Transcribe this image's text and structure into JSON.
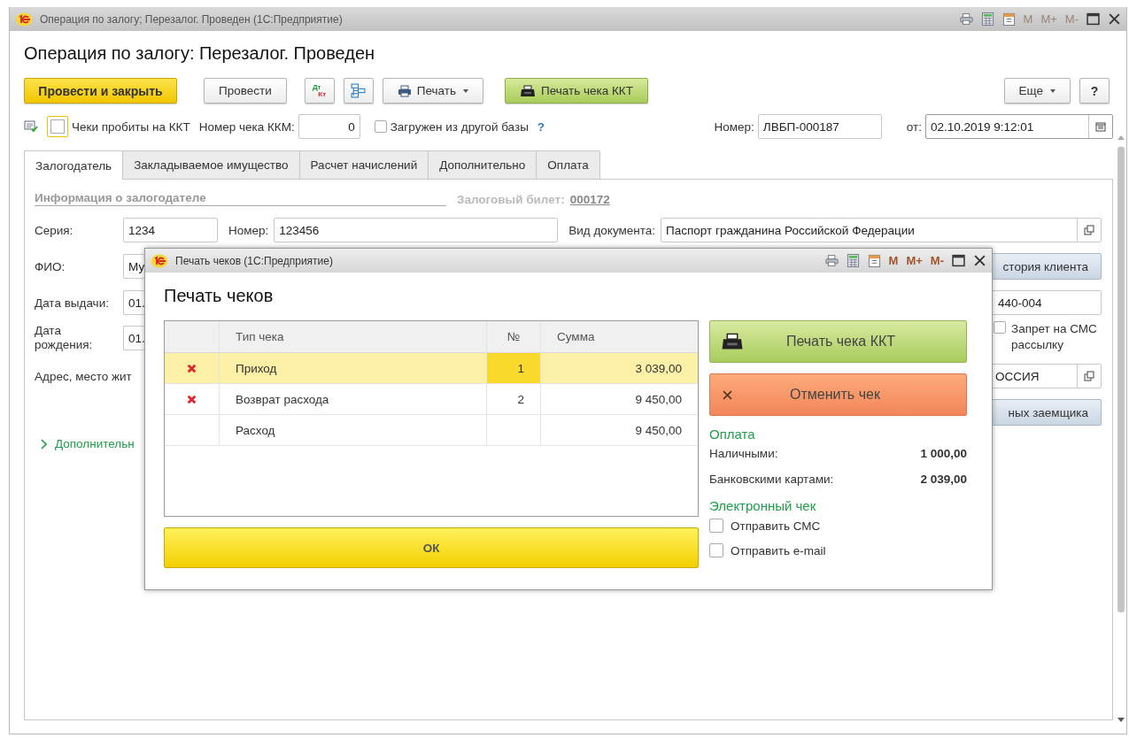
{
  "window": {
    "title": "Операция по залогу; Перезалог. Проведен  (1С:Предприятие)",
    "title_tools": [
      {
        "kind": "print"
      },
      {
        "kind": "calc"
      },
      {
        "kind": "calendar"
      },
      {
        "kind": "mem",
        "label": "M",
        "disabled": true
      },
      {
        "kind": "mem",
        "label": "M+",
        "disabled": true
      },
      {
        "kind": "mem",
        "label": "M-",
        "disabled": true
      },
      {
        "kind": "maximize"
      },
      {
        "kind": "close"
      }
    ]
  },
  "heading": "Операция по залогу: Перезалог. Проведен",
  "toolbar_left": [
    {
      "kind": "primary",
      "label": "Провести и закрыть"
    },
    {
      "kind": "plain",
      "label": "Провести"
    },
    {
      "kind": "dtkt",
      "label": "Дт",
      "label2": "Кт"
    },
    {
      "kind": "structure"
    },
    {
      "kind": "print_menu",
      "label": "Печать"
    },
    {
      "kind": "accent",
      "label": "Печать чека ККТ"
    }
  ],
  "toolbar_right": [
    {
      "kind": "menu",
      "label": "Еще"
    },
    {
      "kind": "plain",
      "label": "?"
    }
  ],
  "header_line": {
    "receipts_printed": {
      "label": "Чеки пробиты на ККТ",
      "checked": false
    },
    "kkm_number": {
      "label": "Номер чека ККМ:",
      "value": "0"
    },
    "loaded": {
      "label": "Загружен из другой базы",
      "checked": false,
      "help": "?"
    },
    "number": {
      "label": "Номер:",
      "value": "ЛВБП-000187"
    },
    "date": {
      "label": "от:",
      "value": "02.10.2019  9:12:01"
    }
  },
  "tabs": [
    {
      "label": "Залогодатель",
      "selected": true
    },
    {
      "label": "Закладываемое имущество",
      "selected": false
    },
    {
      "label": "Расчет начислений",
      "selected": false
    },
    {
      "label": "Дополнительно",
      "selected": false
    },
    {
      "label": "Оплата",
      "selected": false
    }
  ],
  "pledger": {
    "section": "Информация о залогодателе",
    "ticket_label": "Залоговый билет:",
    "ticket": "000172",
    "series": {
      "label": "Серия:",
      "value": "1234"
    },
    "doc_number": {
      "label": "Номер:",
      "value": "123456"
    },
    "doc_type": {
      "label": "Вид документа:",
      "value": "Паспорт гражданина Российской Федерации"
    },
    "fio": {
      "label": "ФИО:",
      "value": "Му"
    },
    "issue_date": {
      "label": "Дата выдачи:",
      "value": "01."
    },
    "birth_date": {
      "label": "Дата рождения:",
      "value": "01."
    },
    "address": {
      "label": "Адрес, место жит"
    },
    "history_button": "стория клиента",
    "code_value": "440-004",
    "sms_ban": {
      "label": "Запрет на СМС рассылку",
      "checked": false
    },
    "country_value": "ОССИЯ",
    "borrower_button": "ных заемщика",
    "more": {
      "label": "Дополнительн",
      "expanded": false
    }
  },
  "dialog": {
    "title": "Печать чеков  (1С:Предприятие)",
    "title_tools": [
      {
        "kind": "print"
      },
      {
        "kind": "calc"
      },
      {
        "kind": "calendar"
      },
      {
        "kind": "mem",
        "label": "M",
        "disabled": false
      },
      {
        "kind": "mem",
        "label": "M+",
        "disabled": false
      },
      {
        "kind": "mem",
        "label": "M-",
        "disabled": false
      },
      {
        "kind": "maximize"
      },
      {
        "kind": "close"
      }
    ],
    "heading": "Печать чеков",
    "columns": [
      "Тип чека",
      "№",
      "Сумма"
    ],
    "rows": [
      {
        "marked": true,
        "type": "Приход",
        "number": "1",
        "sum": "3 039,00",
        "selected": true
      },
      {
        "marked": true,
        "type": "Возврат расхода",
        "number": "2",
        "sum": "9 450,00",
        "selected": false
      },
      {
        "marked": false,
        "type": "Расход",
        "sum": "9 450,00",
        "selected": false
      }
    ],
    "ok": "ОК",
    "print_button": "Печать чека ККТ",
    "cancel_button": "Отменить чек",
    "payment_title": "Оплата",
    "payments": [
      {
        "label": "Наличными:",
        "value": "1 000,00"
      },
      {
        "label": "Банковскими картами:",
        "value": "2 039,00"
      }
    ],
    "echeck_title": "Электронный чек",
    "echeck": [
      {
        "label": "Отправить СМС",
        "checked": false
      },
      {
        "label": "Отправить e-mail",
        "checked": false
      }
    ]
  }
}
